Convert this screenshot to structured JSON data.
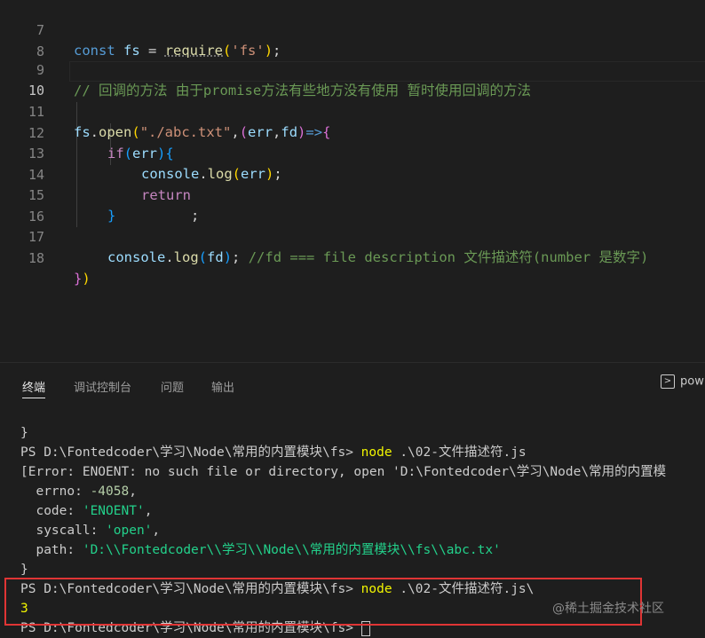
{
  "editor": {
    "lines": [
      {
        "num": "7"
      },
      {
        "num": "8"
      },
      {
        "num": "9",
        "comment": "// 回调的方法 由于promise方法有些地方没有使用 暂时使用回调的方法"
      },
      {
        "num": "10"
      },
      {
        "num": "11"
      },
      {
        "num": "12"
      },
      {
        "num": "13"
      },
      {
        "num": "14"
      },
      {
        "num": "15"
      },
      {
        "num": "16"
      },
      {
        "num": "17",
        "comment": "//fd === file description 文件描述符(number 是数字)"
      },
      {
        "num": "18"
      }
    ],
    "tokens": {
      "const": "const",
      "fs": "fs",
      "eq": " = ",
      "require": "require",
      "fs_str": "'fs'",
      "open": "open",
      "path_str": "\"./abc.txt\"",
      "err": "err",
      "fd": "fd",
      "arrow": "=>",
      "if": "if",
      "console": "console",
      "log": "log",
      "return": "return"
    }
  },
  "panel": {
    "tabs": [
      {
        "label": "终端",
        "active": true
      },
      {
        "label": "调试控制台",
        "active": false
      },
      {
        "label": "问题",
        "active": false
      },
      {
        "label": "输出",
        "active": false
      }
    ],
    "shell_label": "pow"
  },
  "terminal": {
    "lines": [
      "}",
      "PS D:\\Fontedcoder\\学习\\Node\\常用的内置模块\\fs>",
      "[Error: ENOENT: no such file or directory, open 'D:\\Fontedcoder\\学习\\Node\\常用的内置模",
      "  errno: ",
      "  code: ",
      "  syscall: ",
      "  path: ",
      "}",
      "PS D:\\Fontedcoder\\学习\\Node\\常用的内置模块\\fs>",
      "3",
      "PS D:\\Fontedcoder\\学习\\Node\\常用的内置模块\\fs> "
    ],
    "cmd1": "node",
    "cmd1_args": " .\\02-文件描述符.js",
    "cmd2": "node",
    "cmd2_args": " .\\02-文件描述符.js\\",
    "errno": "-4058",
    "code": "'ENOENT'",
    "syscall": "'open'",
    "path": "'D:\\\\Fontedcoder\\\\学习\\\\Node\\\\常用的内置模块\\\\fs\\\\abc.tx'",
    "comma": ","
  },
  "watermark": "@稀土掘金技术社区",
  "colors": {
    "highlight_border": "#e03535",
    "prompt_command": "#f1f500",
    "string": "#23d18b"
  }
}
